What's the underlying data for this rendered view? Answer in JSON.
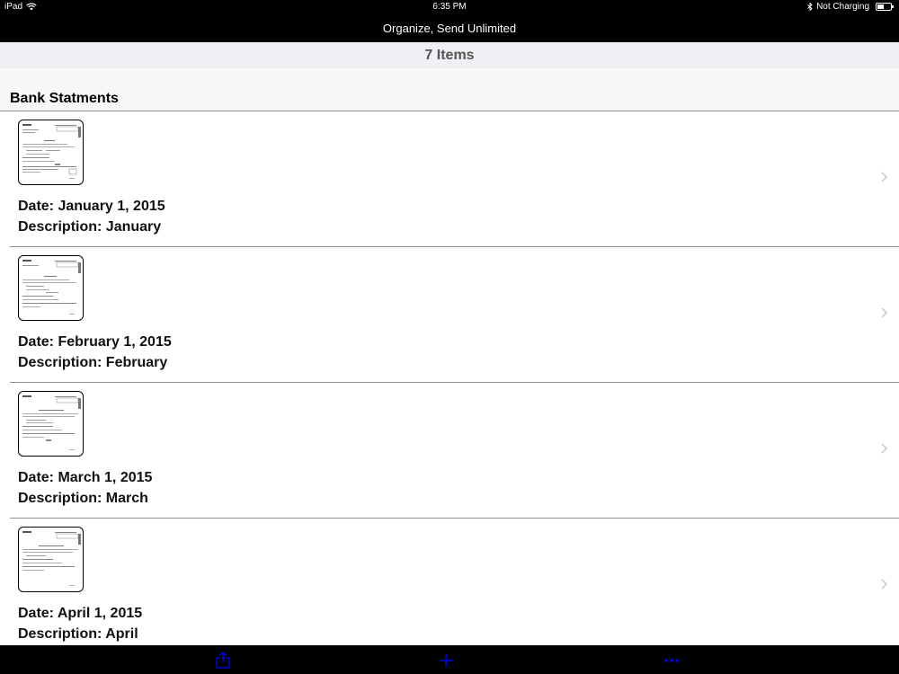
{
  "status_bar": {
    "device": "iPad",
    "time": "6:35 PM",
    "charging": "Not Charging",
    "battery_level": 0.5
  },
  "nav": {
    "title": "Organize, Send Unlimited"
  },
  "items_bar": {
    "count_label": "7 Items"
  },
  "section": {
    "title": "Bank Statments"
  },
  "rows": [
    {
      "date": "Date: January 1, 2015",
      "description": "Description: January"
    },
    {
      "date": "Date: February 1, 2015",
      "description": "Description: February"
    },
    {
      "date": "Date: March 1, 2015",
      "description": "Description: March"
    },
    {
      "date": "Date: April 1, 2015",
      "description": "Description: April"
    }
  ],
  "toolbar": {
    "icons": [
      "share-icon",
      "add-icon",
      "more-icon"
    ],
    "icon_color": "#0000ff"
  },
  "icons": {
    "wifi": "wifi-icon",
    "bluetooth": "bluetooth-icon",
    "battery": "battery-icon",
    "chevron": "chevron-right-icon"
  }
}
